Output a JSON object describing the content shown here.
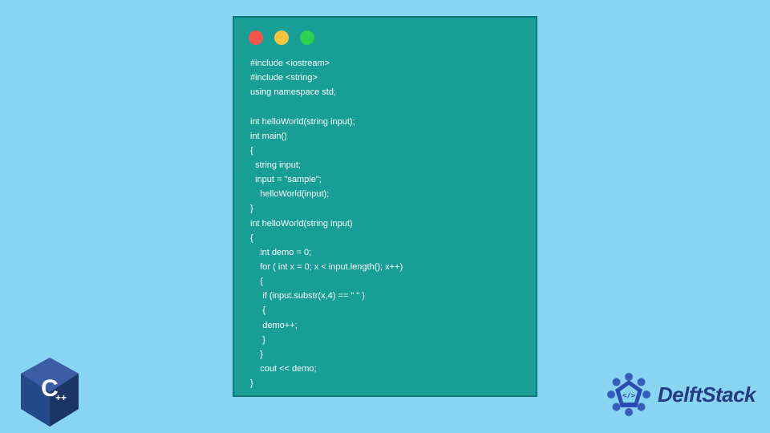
{
  "window": {
    "dots": [
      "red",
      "yellow",
      "green"
    ]
  },
  "code": "#include <iostream>\n#include <string>\nusing namespace std;\n\nint helloWorld(string input);\nint main()\n{\n  string input;\n  input = \"sample\";\n    helloWorld(input);\n}\nint helloWorld(string input)\n{\n    int demo = 0;\n    for ( int x = 0; x < input.length(); x++)\n    {\n     if (input.substr(x,4) == \" \" )\n     {\n     demo++;\n     }\n    }\n    cout << demo;\n}",
  "branding": {
    "cpp_label": "C++",
    "site_name": "DelftStack"
  },
  "colors": {
    "page_bg": "#87d5f2",
    "window_bg": "#179e97",
    "code_text": "#ffffff",
    "cpp_blue": "#244987",
    "delft_blue": "#263b80"
  }
}
